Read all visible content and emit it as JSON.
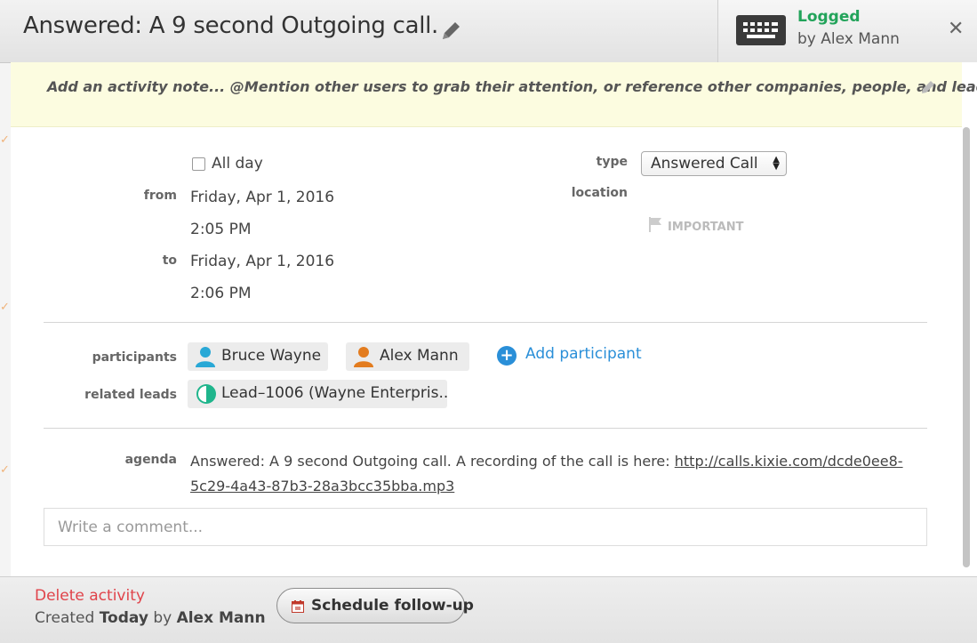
{
  "header": {
    "title": "Answered: A 9 second Outgoing call.",
    "status": "Logged",
    "logged_by": "by Alex Mann"
  },
  "note": {
    "placeholder": "Add an activity note... @Mention other users to grab their attention, or reference other companies, people, and leads."
  },
  "details": {
    "all_day_label": "All day",
    "from_label": "from",
    "from_date": "Friday, Apr 1, 2016",
    "from_time": "2:05 PM",
    "to_label": "to",
    "to_date": "Friday, Apr 1, 2016",
    "to_time": "2:06 PM",
    "type_label": "type",
    "type_value": "Answered Call",
    "location_label": "location",
    "important_label": "IMPORTANT"
  },
  "participants": {
    "label": "participants",
    "items": [
      {
        "name": "Bruce Wayne"
      },
      {
        "name": "Alex Mann"
      }
    ],
    "add_label": "Add participant"
  },
  "related_leads": {
    "label": "related leads",
    "items": [
      {
        "name": "Lead–1006 (Wayne Enterpris..."
      }
    ]
  },
  "agenda": {
    "label": "agenda",
    "text": "Answered: A 9 second Outgoing call. A recording of the call is here: ",
    "link": "http://calls.kixie.com/dcde0ee8-5c29-4a43-87b3-28a3bcc35bba.mp3"
  },
  "comment": {
    "placeholder": "Write a comment..."
  },
  "footer": {
    "delete_label": "Delete activity",
    "created_prefix": "Created",
    "created_when": "Today",
    "created_by_word": "by",
    "created_user": "Alex Mann",
    "followup_label": "Schedule follow-up"
  },
  "colors": {
    "logged": "#22a35a",
    "link_blue": "#2a8fd8",
    "delete_red": "#e0434a",
    "note_bg": "#fcfce0",
    "participant_1_icon": "#29a8d6",
    "participant_2_icon": "#e37c1f",
    "lead_icon": "#1fb58c"
  },
  "icons": {
    "title_edit": "pencil-icon",
    "logged": "keyboard-icon",
    "close": "close-icon",
    "important": "flag-icon",
    "participant": "person-icon",
    "lead": "lead-pie-icon",
    "add": "plus-circle-icon",
    "followup": "calendar-icon"
  }
}
